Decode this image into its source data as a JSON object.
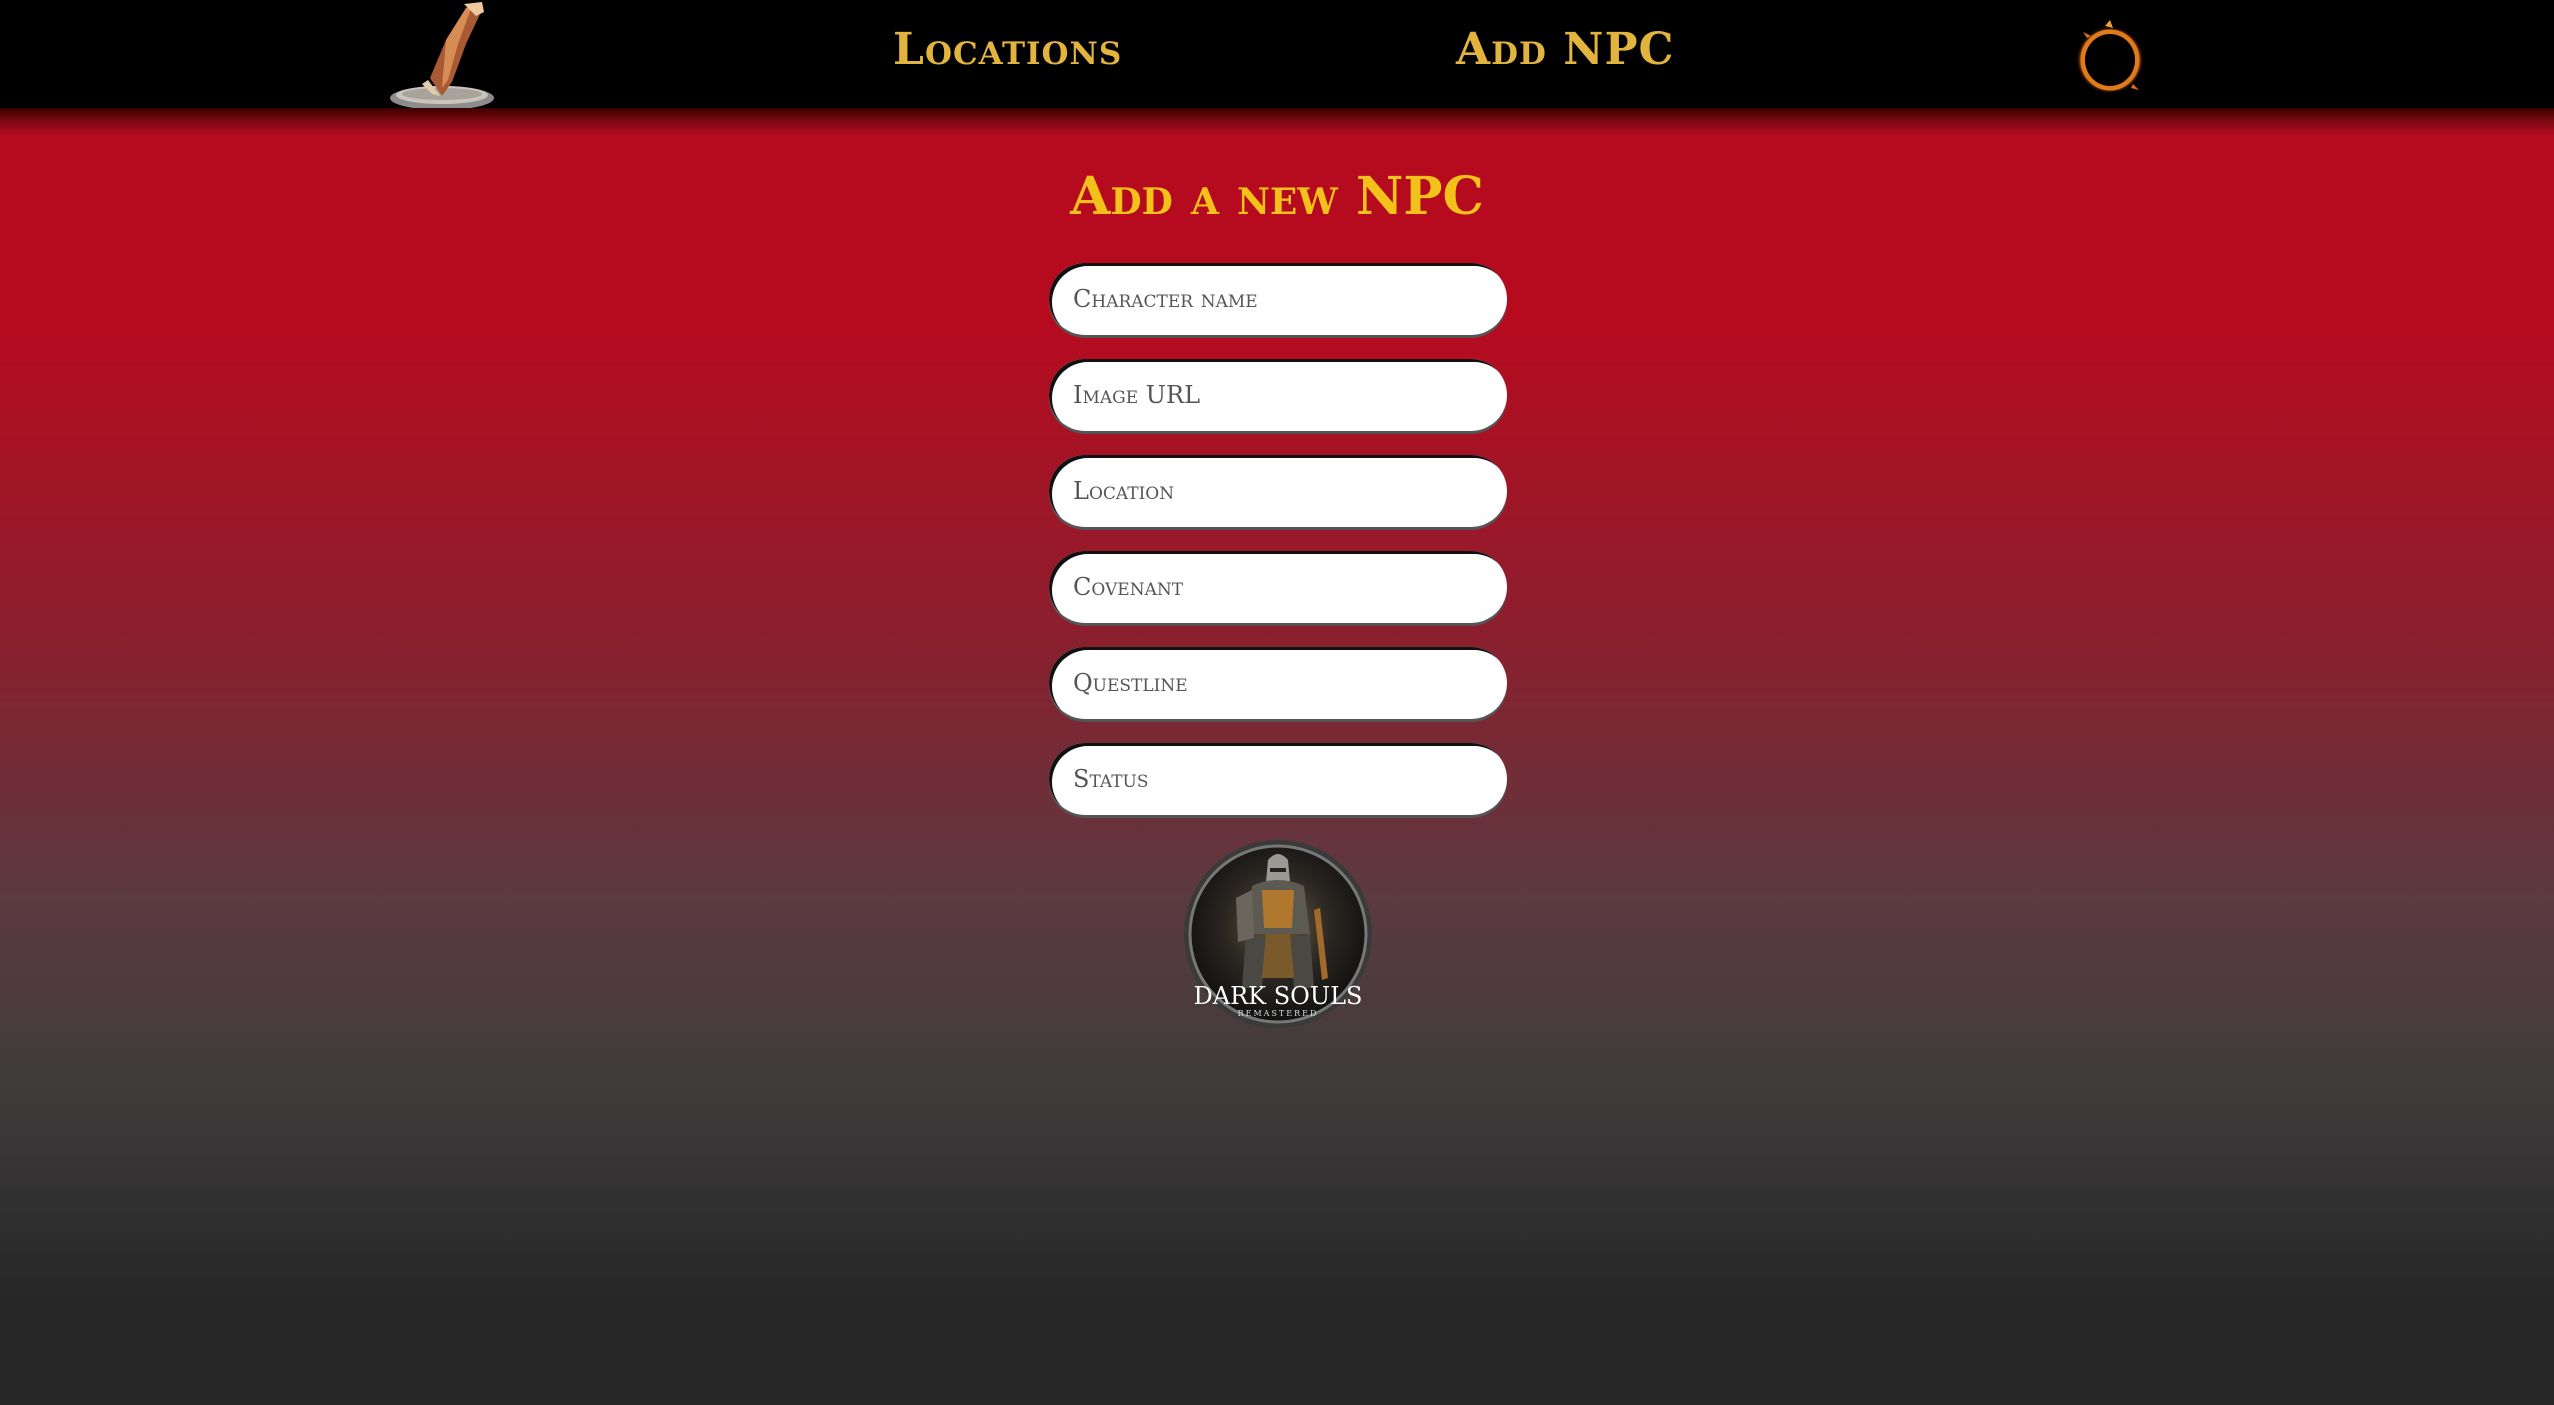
{
  "nav": {
    "logo_icon": "bone-shard-icon",
    "links": [
      {
        "label": "Locations"
      },
      {
        "label": "Add NPC"
      }
    ],
    "ring_icon": "darksign-ring-icon"
  },
  "page": {
    "title": "Add a new NPC"
  },
  "form": {
    "fields": [
      {
        "placeholder": "Character name",
        "value": ""
      },
      {
        "placeholder": "Image URL",
        "value": ""
      },
      {
        "placeholder": "Location",
        "value": ""
      },
      {
        "placeholder": "Covenant",
        "value": ""
      },
      {
        "placeholder": "Questline",
        "value": ""
      },
      {
        "placeholder": "Status",
        "value": ""
      }
    ]
  },
  "emblem": {
    "icon": "dark-souls-knight-emblem",
    "title": "DARK SOULS",
    "subtitle": "REMASTERED"
  },
  "colors": {
    "nav_background": "#000000",
    "nav_link": "#e2b43e",
    "title": "#f2c21a",
    "background_top": "#b60b1f",
    "background_bottom": "#262626",
    "field_background": "#ffffff"
  }
}
